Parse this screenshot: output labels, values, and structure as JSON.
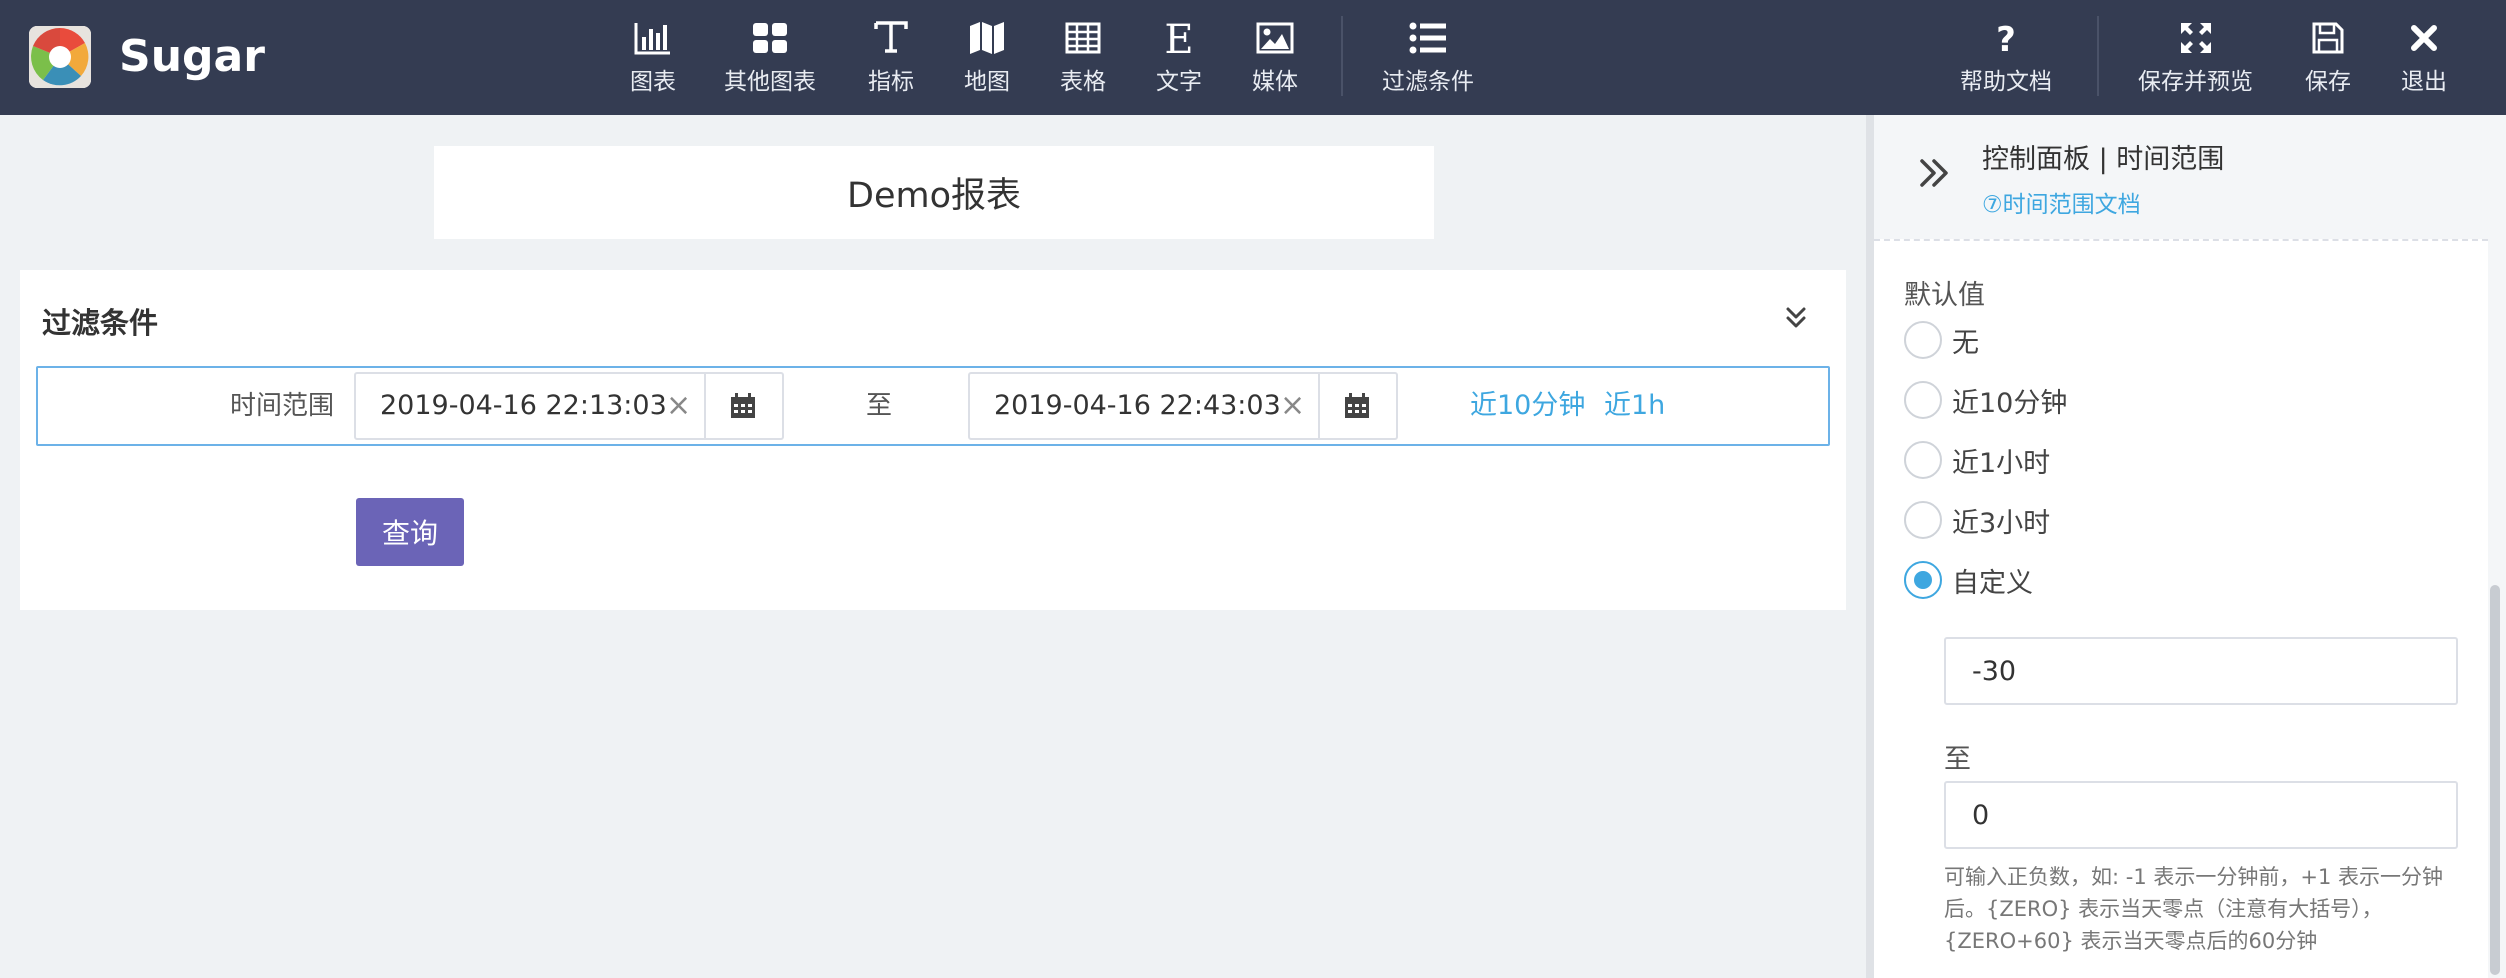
{
  "app": {
    "name": "Sugar"
  },
  "toolbar": {
    "items": [
      {
        "label": "图表",
        "icon": "bar-chart-icon"
      },
      {
        "label": "其他图表",
        "icon": "grid-icon"
      },
      {
        "label": "指标",
        "icon": "text-metric-icon"
      },
      {
        "label": "地图",
        "icon": "map-icon"
      },
      {
        "label": "表格",
        "icon": "table-icon"
      },
      {
        "label": "文字",
        "icon": "text-icon"
      },
      {
        "label": "媒体",
        "icon": "image-icon"
      },
      {
        "label": "过滤条件",
        "icon": "list-icon"
      }
    ],
    "right_items": [
      {
        "label": "帮助文档",
        "icon": "question-icon"
      },
      {
        "label": "保存并预览",
        "icon": "expand-icon"
      },
      {
        "label": "保存",
        "icon": "save-icon"
      },
      {
        "label": "退出",
        "icon": "close-icon"
      }
    ]
  },
  "report": {
    "title": "Demo报表"
  },
  "filter": {
    "title": "过滤条件",
    "row_label": "时间范围",
    "start": "2019-04-16 22:13:03",
    "to": "至",
    "end": "2019-04-16 22:43:03",
    "clear": "×",
    "quick": [
      "近10分钟",
      "近1h"
    ],
    "query_button": "查询"
  },
  "panel": {
    "title": "控制面板 | 时间范围",
    "doc_link": "⑦时间范围文档",
    "default_label": "默认值",
    "options": [
      "无",
      "近10分钟",
      "近1小时",
      "近3小时",
      "自定义"
    ],
    "selected": "自定义",
    "custom_start": "-30",
    "to": "至",
    "custom_end": "0",
    "help": "可输入正负数，如: -1 表示一分钟前，+1 表示一分钟后。{ZERO} 表示当天零点（注意有大括号），{ZERO+60} 表示当天零点后的60分钟"
  },
  "colors": {
    "topbar": "#343c52",
    "accent": "#3ea7e0",
    "query_button": "#6b64b7"
  }
}
